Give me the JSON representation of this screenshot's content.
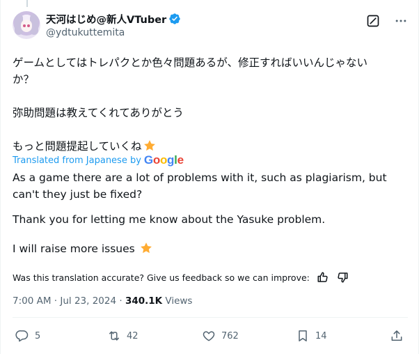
{
  "author": {
    "display_name": "天河はじめ@新人VTuber",
    "handle": "@ydtukuttemita",
    "verified": true
  },
  "tweet": {
    "original_lines": [
      "ゲームとしてはトレパクとか色々問題あるが、修正すればいいんじゃない",
      "か？",
      "弥助問題は教えてくれてありがとう",
      "もっと問題提起していくね"
    ],
    "translated_label": "Translated from Japanese by",
    "translated_brand": "Google",
    "translation_lines": [
      "As a game there are a lot of problems with it, such as plagiarism, but",
      "can't they just be fixed?",
      "Thank you for letting me know about the Yasuke problem.",
      "I will raise more issues"
    ],
    "feedback_prompt": "Was this translation accurate? Give us feedback so we can improve:",
    "timestamp": "7:00 AM · Jul 23, 2024 · ",
    "views_count": "340.1K",
    "views_label": " Views"
  },
  "actions": {
    "replies": "5",
    "reposts": "42",
    "likes": "762",
    "bookmarks": "14"
  },
  "icons": {
    "verified": "verified-badge-icon",
    "grok": "grok-icon",
    "more": "more-icon",
    "star": "star-emoji-icon",
    "thumb_up": "thumb-up-icon",
    "thumb_down": "thumb-down-icon",
    "reply": "reply-icon",
    "repost": "repost-icon",
    "like": "heart-icon",
    "bookmark": "bookmark-icon",
    "share": "share-icon"
  },
  "colors": {
    "accent": "#1d9bf0",
    "text": "#0f1419",
    "secondary": "#536471",
    "star": "#ffac33"
  }
}
